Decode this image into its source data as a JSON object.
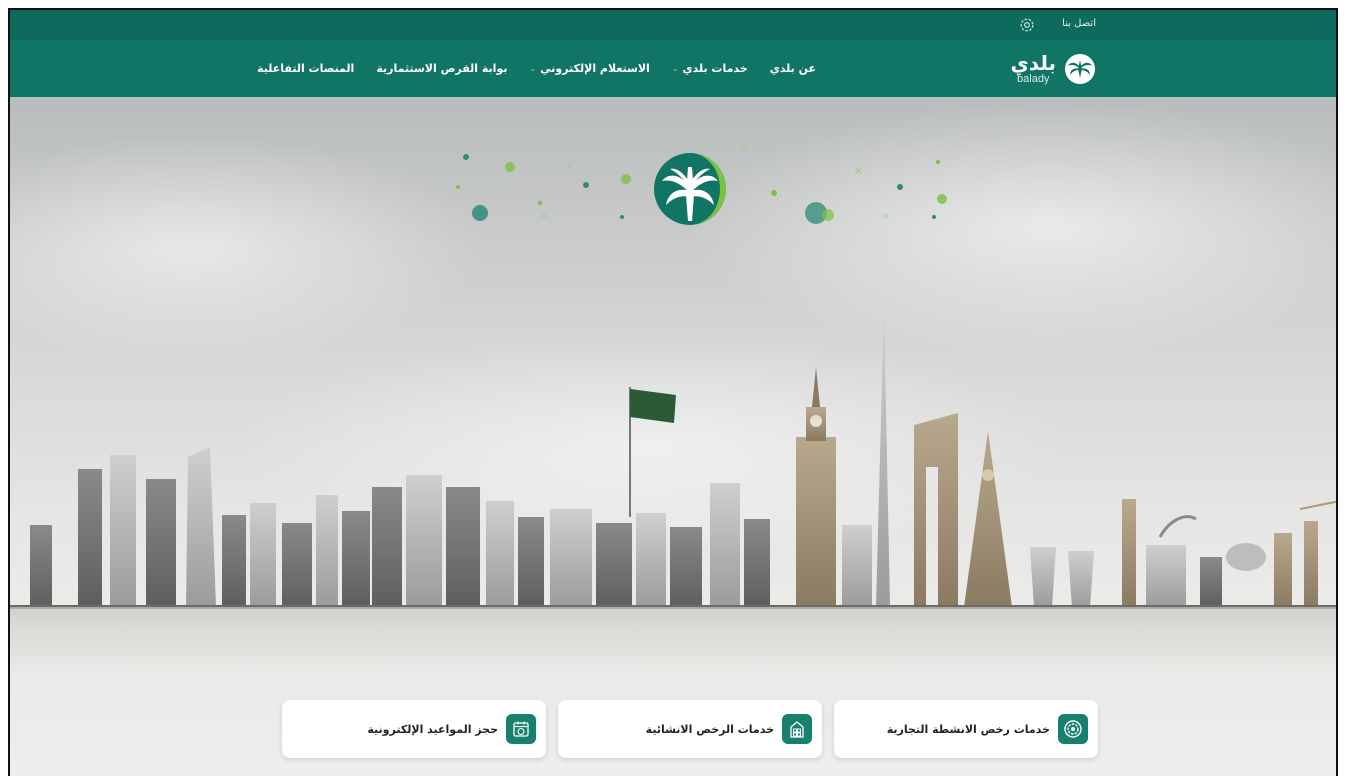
{
  "topbar": {
    "contact_label": "اتصل بنا"
  },
  "logo": {
    "arabic": "بلدي",
    "latin": "balady"
  },
  "nav": {
    "items": [
      {
        "label": "عن بلدي",
        "has_dropdown": false
      },
      {
        "label": "خدمات بلدي",
        "has_dropdown": true
      },
      {
        "label": "الاستعلام الإلكتروني",
        "has_dropdown": true
      },
      {
        "label": "بوابة الفرص الاستثمارية",
        "has_dropdown": false
      },
      {
        "label": "المنصات التفاعلية",
        "has_dropdown": false
      }
    ]
  },
  "services": [
    {
      "label": "خدمات رخص الانشطة التجارية",
      "icon": "license-gear-icon"
    },
    {
      "label": "خدمات الرخص الانشائية",
      "icon": "building-icon"
    },
    {
      "label": "حجز المواعيد الإلكترونية",
      "icon": "calendar-icon"
    }
  ],
  "colors": {
    "topbar": "#0d6b5e",
    "nav": "#117566",
    "accent": "#17806f",
    "brand_light_green": "#7cc242"
  }
}
